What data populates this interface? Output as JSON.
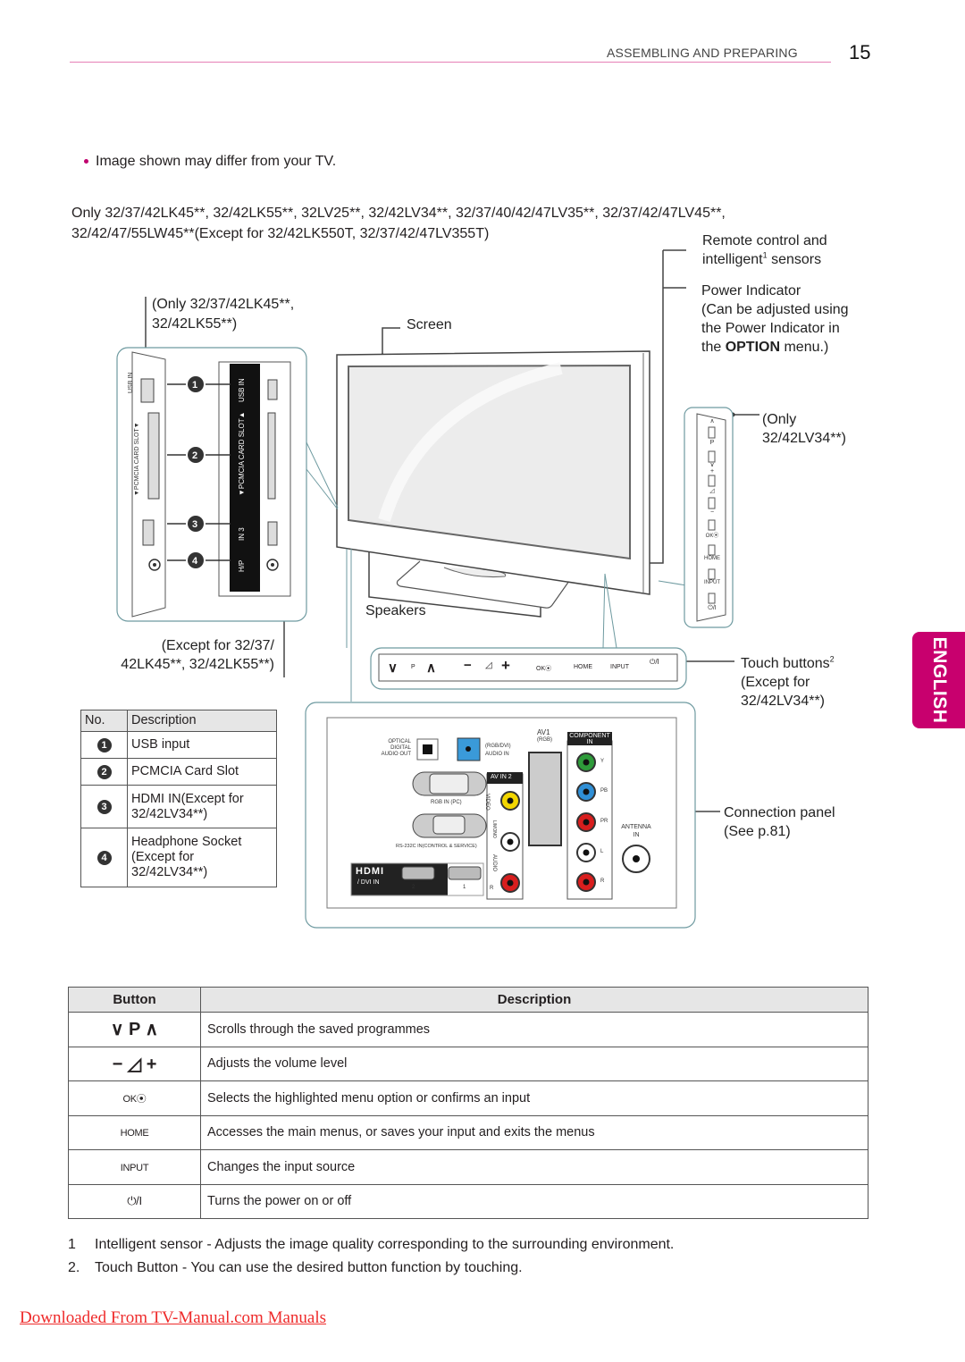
{
  "header": {
    "section_title": "ASSEMBLING AND PREPARING",
    "page_number": "15"
  },
  "note_bullet": "Image shown may differ from your TV.",
  "models_line_1": "Only 32/37/42LK45**, 32/42LK55**, 32LV25**, 32/42LV34**, 32/37/40/42/47LV35**, 32/37/42/47LV45**,",
  "models_line_2": "32/42/47/55LW45**(Except for 32/42LK550T, 32/37/42/47LV355T)",
  "callouts": {
    "remote_sensor_1": "Remote control and",
    "remote_sensor_2a": "intelligent",
    "remote_sensor_sup": "1",
    "remote_sensor_2b": " sensors",
    "power_indicator_1": "Power Indicator",
    "power_indicator_2": "(Can be adjusted using",
    "power_indicator_3": "the Power Indicator in",
    "power_indicator_4a": "the ",
    "power_indicator_4b": "OPTION",
    "power_indicator_4c": " menu.)",
    "only_lk_1": "(Only 32/37/42LK45**,",
    "only_lk_2": "32/42LK55**)",
    "screen": "Screen",
    "only_lv34_1": "(Only",
    "only_lv34_2": "32/42LV34**)",
    "speakers": "Speakers",
    "except_lk_1": "(Except for 32/37/",
    "except_lk_2": "42LK45**, 32/42LK55**)",
    "touch_buttons_1": "Touch buttons",
    "touch_buttons_sup": "2",
    "touch_buttons_2": "(Except for",
    "touch_buttons_3": "32/42LV34**)",
    "connection_panel_1": "Connection panel",
    "connection_panel_2": "(See p.81)"
  },
  "side_panel_labels": {
    "usb_in": "USB IN",
    "pcmcia": "▼PCMCIA CARD SLOT▼",
    "pcmcia_alt": "▼PCMCIA CARD SLOT▲",
    "hdmi_in3": "IN 3",
    "hp": "H/P",
    "markers": [
      "1",
      "2",
      "3",
      "4"
    ]
  },
  "vertical_buttons": [
    "∧",
    "P",
    "∨",
    "+",
    "◿",
    "−",
    "OK⦿",
    "HOME",
    "INPUT",
    "⏻/I"
  ],
  "touch_strip": {
    "down": "∨",
    "p": "P",
    "up": "∧",
    "minus": "−",
    "vol": "◿",
    "plus": "+",
    "ok": "OK⦿",
    "home": "HOME",
    "input": "INPUT",
    "power": "⏻/I"
  },
  "connection_panel": {
    "optical": [
      "OPTICAL",
      "DIGITAL",
      "AUDIO OUT"
    ],
    "rgb_dvi_audio": [
      "(RGB/DVI)",
      "AUDIO IN"
    ],
    "rgb_in": "RGB IN (PC)",
    "rs232c": "RS-232C IN(CONTROL & SERVICE)",
    "hdmi_logo": "HDMI",
    "dvi_in": "/ DVI IN",
    "hdmi_ports": [
      "2",
      "1"
    ],
    "av_in2": "AV IN 2",
    "video": "VIDEO",
    "l_mono": "L/MONO",
    "audio": "AUDIO",
    "r": "R",
    "av1": "AV1",
    "av1_rgb": "(RGB)",
    "component": [
      "COMPONENT",
      "IN"
    ],
    "component_ports": [
      "Y",
      "PB",
      "PR",
      "L",
      "R"
    ],
    "antenna": [
      "ANTENNA",
      "IN"
    ],
    "colors": {
      "green": "#2e9b3a",
      "blue": "#2f8fd6",
      "red": "#d81e1e",
      "yellow": "#f2d600",
      "white": "#ffffff",
      "optical_blue": "#3a9ad9"
    }
  },
  "number_table": {
    "headers": [
      "No.",
      "Description"
    ],
    "rows": [
      {
        "no": "1",
        "desc_1": "USB input",
        "desc_2": "",
        "desc_3": ""
      },
      {
        "no": "2",
        "desc_1": "PCMCIA Card Slot",
        "desc_2": "",
        "desc_3": ""
      },
      {
        "no": "3",
        "desc_1": "HDMI IN(Except for",
        "desc_2": "32/42LV34**)",
        "desc_3": ""
      },
      {
        "no": "4",
        "desc_1": "Headphone Socket",
        "desc_2": "(Except for",
        "desc_3": "32/42LV34**)"
      }
    ]
  },
  "button_table": {
    "headers": [
      "Button",
      "Description"
    ],
    "rows": [
      {
        "button": "∨  P  ∧",
        "desc": "Scrolls through the saved programmes"
      },
      {
        "button": "−  ◿  +",
        "desc": "Adjusts the volume level"
      },
      {
        "button": "OK⦿",
        "desc": "Selects the highlighted menu option or confirms an input"
      },
      {
        "button": "HOME",
        "desc": "Accesses the main menus, or saves your input and exits the menus"
      },
      {
        "button": "INPUT",
        "desc": "Changes the input source"
      },
      {
        "button": "⏻/I",
        "desc": "Turns the power on or off"
      }
    ]
  },
  "footnotes": [
    {
      "marker": "1",
      "text": "Intelligent sensor - Adjusts the image quality corresponding to the surrounding environment."
    },
    {
      "marker": "2.",
      "text": "Touch Button - You can use the desired button function by touching."
    }
  ],
  "language_tab": "ENGLISH",
  "download_link": "Downloaded From TV-Manual.com Manuals",
  "colors": {
    "brand_magenta": "#c8006e",
    "header_rule": "#e67fb6",
    "link_red": "#ee2a2a"
  }
}
